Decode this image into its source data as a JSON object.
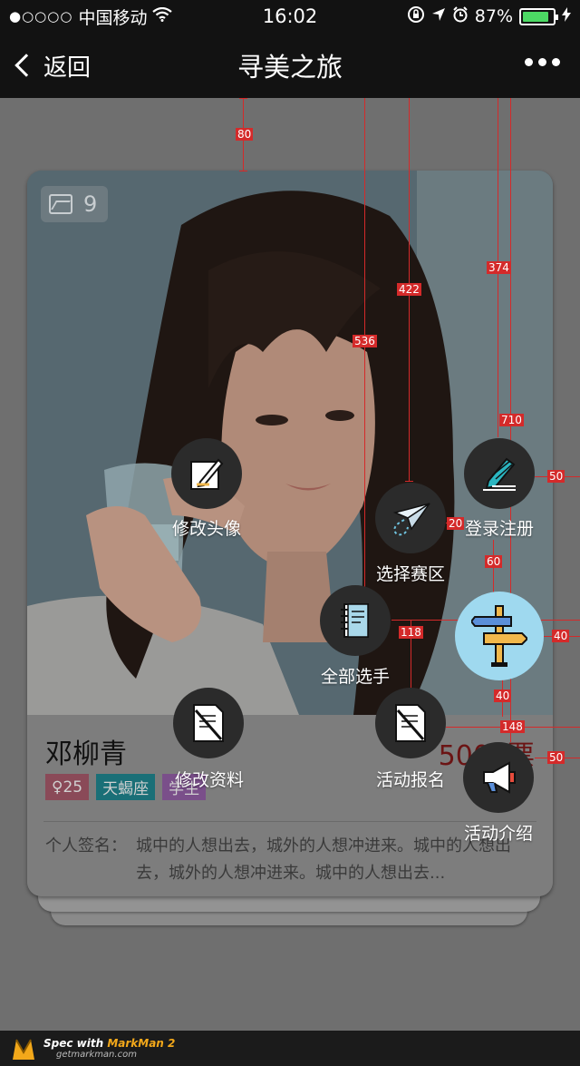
{
  "status_bar": {
    "signal": "●○○○○",
    "carrier": "中国移动",
    "time": "16:02",
    "battery_text": "87%",
    "battery_level": 0.87,
    "battery_color": "#4cd964"
  },
  "nav": {
    "back_label": "返回",
    "title": "寻美之旅"
  },
  "card": {
    "photo_count": "9",
    "name": "邓柳青",
    "votes": "5000票",
    "tags": [
      "♀25",
      "天蝎座",
      "学生"
    ],
    "signature_label": "个人签名：",
    "signature_text": "城中的人想出去，城外的人想冲进来。城中的人想出去，城外的人想冲进来。城中的人想出去..."
  },
  "actions": {
    "edit_avatar": "修改头像",
    "login_register": "登录注册",
    "choose_zone": "选择赛区",
    "all_players": "全部选手",
    "edit_profile": "修改资料",
    "activity_signup": "活动报名",
    "activity_intro": "活动介绍"
  },
  "spec_dims": {
    "d80": "80",
    "d422": "422",
    "d374": "374",
    "d536": "536",
    "d710": "710",
    "d50a": "50",
    "d20": "20",
    "d60": "60",
    "d208": "208",
    "d40a": "40",
    "d118": "118",
    "d40b": "40",
    "d148": "148",
    "d50b": "50"
  },
  "footer": {
    "spec_with": "Spec with",
    "product": "MarkMan 2",
    "site": "getmarkman.com"
  },
  "colors": {
    "accent_red": "#d42a2a",
    "main_button": "#9fd9ef",
    "tag_age": "#8a4a58",
    "tag_star": "#1a6f77",
    "tag_job": "#7a4f8a"
  }
}
